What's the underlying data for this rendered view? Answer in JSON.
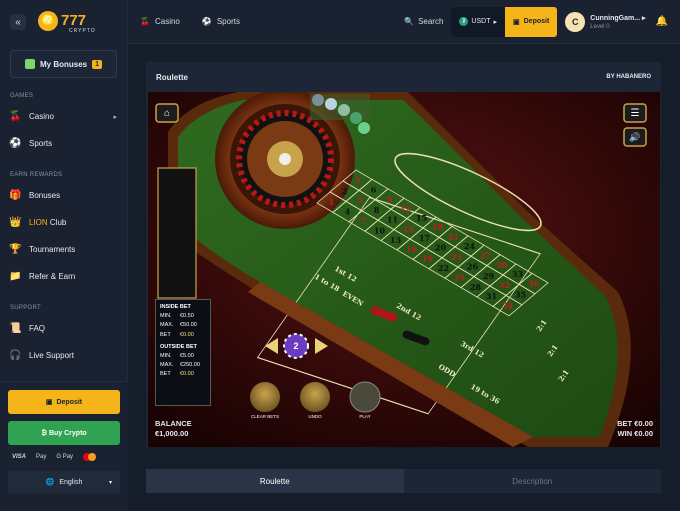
{
  "sidebar": {
    "collapse_icon": "«",
    "logo_text": "777",
    "logo_sub": "CRYPTO",
    "my_bonuses": "My Bonuses",
    "my_bonuses_count": "1",
    "games_header": "GAMES",
    "casino": "Casino",
    "sports": "Sports",
    "earn_header": "EARN REWARDS",
    "bonuses": "Bonuses",
    "lion_prefix": "LION",
    "lion_club": " Club",
    "tournaments": "Tournaments",
    "refer": "Refer & Earn",
    "support_header": "SUPPORT",
    "faq": "FAQ",
    "live_support": "Live Support",
    "deposit": "Deposit",
    "buy_crypto": "₿ Buy Crypto",
    "pay_visa": "VISA",
    "pay_apple": "Pay",
    "pay_google": "G Pay",
    "language": "English"
  },
  "header": {
    "nav_casino": "Casino",
    "nav_sports": "Sports",
    "search": "Search",
    "currency": "USDT",
    "deposit": "Deposit",
    "user_initial": "C",
    "username": "CunningGam...",
    "level": "Level 0"
  },
  "game": {
    "title": "Roulette",
    "provider_prefix": "BY",
    "provider": "HABANERO",
    "inside_bet": "INSIDE BET",
    "inside_min_label": "MIN.",
    "inside_min": "€0.50",
    "inside_max_label": "MAX.",
    "inside_max": "€50.00",
    "inside_bet_label": "BET",
    "inside_bet_val": "€0.00",
    "outside_bet": "OUTSIDE BET",
    "outside_min_label": "MIN.",
    "outside_min": "€5.00",
    "outside_max_label": "MAX.",
    "outside_max": "€250.00",
    "outside_bet_label": "BET",
    "outside_bet_val": "€0.00",
    "balance_label": "BALANCE",
    "balance": "€1,000.00",
    "bet_label": "BET",
    "bet": "€0.00",
    "win_label": "WIN",
    "win": "€0.00",
    "chip_value": "2",
    "clear_bets": "CLEAR BETS",
    "undo": "UNDO",
    "play": "PLAY",
    "table_numbers": [
      "1",
      "2",
      "3",
      "4",
      "5",
      "6",
      "7",
      "8",
      "9",
      "10",
      "11",
      "12",
      "13",
      "14",
      "15",
      "16",
      "17",
      "18",
      "19",
      "20",
      "21",
      "22",
      "23",
      "24",
      "25",
      "26",
      "27",
      "28",
      "29",
      "30",
      "31",
      "32",
      "33",
      "34",
      "35",
      "36"
    ],
    "dozen1": "1st 12",
    "dozen2": "2nd 12",
    "dozen3": "3rd 12",
    "low": "1 to 18",
    "even": "EVEN",
    "odd": "ODD",
    "high": "19 to 36",
    "col": "2:1",
    "zero": "0"
  },
  "tabs": {
    "roulette": "Roulette",
    "description": "Description"
  }
}
